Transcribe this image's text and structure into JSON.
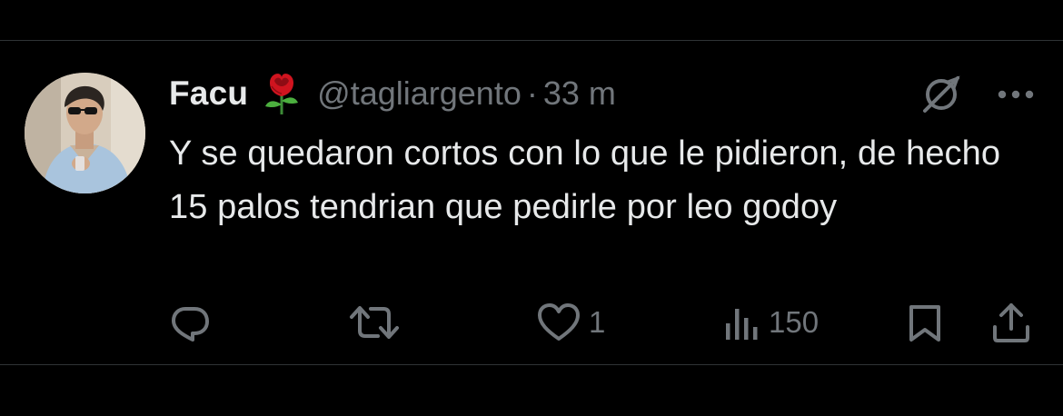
{
  "tweet": {
    "author": {
      "name": "Facu",
      "handle": "@tagliargento",
      "name_emoji": "rose"
    },
    "separator": "·",
    "time": "33 m",
    "text": "Y se quedaron cortos con lo que le pidieron, de hecho 15 palos tendrian que pedirle por leo godoy",
    "actions": {
      "reply": {
        "icon": "reply-icon",
        "count": ""
      },
      "retweet": {
        "icon": "retweet-icon",
        "count": ""
      },
      "like": {
        "icon": "heart-icon",
        "count": "1"
      },
      "views": {
        "icon": "views-icon",
        "count": "150"
      },
      "bookmark": {
        "icon": "bookmark-icon"
      },
      "share": {
        "icon": "share-icon"
      }
    },
    "header_icons": [
      "grok-icon",
      "more-icon"
    ]
  },
  "colors": {
    "background": "#000000",
    "text_primary": "#e7e9ea",
    "text_secondary": "#71767b",
    "divider": "#2f3336"
  }
}
